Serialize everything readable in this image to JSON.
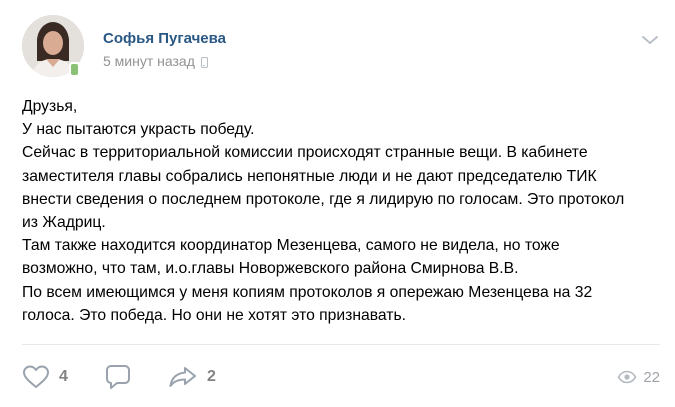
{
  "post": {
    "author": "Софья Пугачева",
    "time": "5 минут назад",
    "text_lines": [
      "Друзья,",
      "У нас пытаются украсть победу.",
      "Сейчас в территориальной комиссии происходят странные вещи. В кабинете",
      "заместителя главы собрались непонятные люди и не дают председателю ТИК",
      "внести сведения о последнем протоколе, где я лидирую по голосам. Это протокол",
      "из Жадриц.",
      "Там также находится координатор Мезенцева, самого не видела, но тоже",
      "возможно, что там, и.о.главы Новоржевского района Смирнова В.В.",
      "По всем имеющимся у меня копиям протоколов я опережаю Мезенцева на 32",
      "голоса. Это победа. Но они не хотят это признавать."
    ]
  },
  "actions": {
    "likes": "4",
    "comments": "",
    "shares": "2",
    "views": "22"
  },
  "icons": {
    "like": "heart-icon",
    "comment": "comment-icon",
    "share": "share-arrow-icon",
    "views": "eye-icon",
    "more": "chevron-down-icon",
    "device": "mobile-phone-icon"
  },
  "colors": {
    "author_link": "#2a5885",
    "muted_text": "#939393",
    "action_icon": "#99a2ad",
    "online": "#8ac176"
  }
}
